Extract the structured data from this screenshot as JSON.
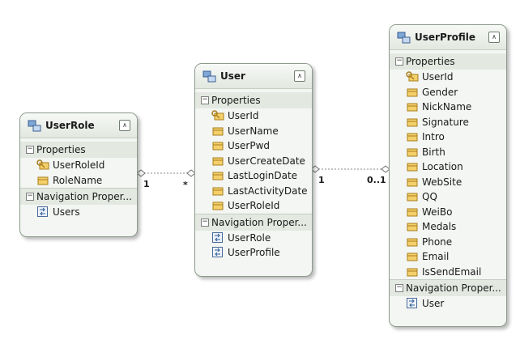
{
  "entities": {
    "userrole": {
      "title": "UserRole",
      "properties_label": "Properties",
      "properties": [
        "UserRoleId",
        "RoleName"
      ],
      "navigation_label": "Navigation Proper...",
      "navigation": [
        "Users"
      ]
    },
    "user": {
      "title": "User",
      "properties_label": "Properties",
      "properties": [
        "UserId",
        "UserName",
        "UserPwd",
        "UserCreateDate",
        "LastLoginDate",
        "LastActivityDate",
        "UserRoleId"
      ],
      "navigation_label": "Navigation Proper...",
      "navigation": [
        "UserRole",
        "UserProfile"
      ]
    },
    "userprofile": {
      "title": "UserProfile",
      "properties_label": "Properties",
      "properties": [
        "UserId",
        "Gender",
        "NickName",
        "Signature",
        "Intro",
        "Birth",
        "Location",
        "WebSite",
        "QQ",
        "WeiBo",
        "Medals",
        "Phone",
        "Email",
        "IsSendEmail"
      ],
      "navigation_label": "Navigation Proper...",
      "navigation": [
        "User"
      ]
    }
  },
  "associations": [
    {
      "from": "UserRole",
      "to": "User",
      "from_multiplicity": "1",
      "to_multiplicity": "*"
    },
    {
      "from": "User",
      "to": "UserProfile",
      "from_multiplicity": "1",
      "to_multiplicity": "0..1"
    }
  ],
  "icons": {
    "entity": "entity-icon",
    "key_property": "key-property-icon",
    "property": "property-icon",
    "navigation_property": "navigation-property-icon",
    "collapse": "collapse-icon"
  },
  "colors": {
    "entity_background": "#f3f6f2",
    "section_background": "#e3e9e1",
    "entity_border": "#8d9a8d",
    "connector": "#8a8a8a"
  }
}
